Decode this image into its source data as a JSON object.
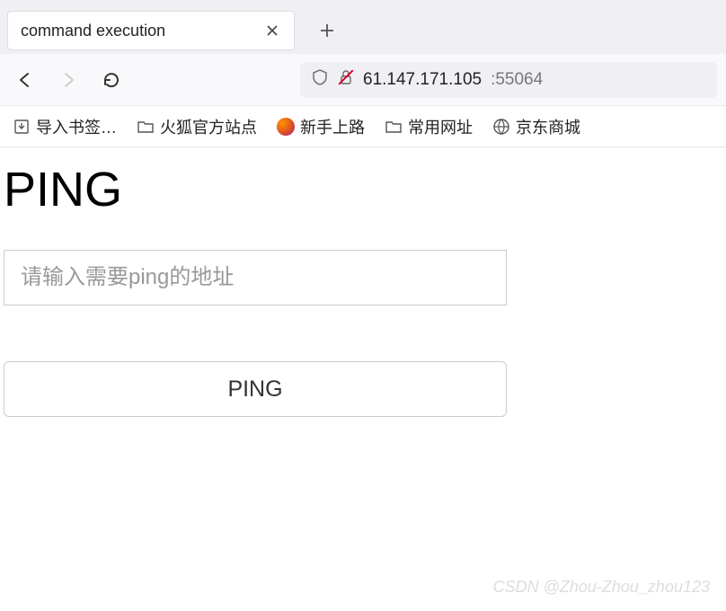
{
  "tab": {
    "title": "command execution"
  },
  "url": {
    "host": "61.147.171.105",
    "port": ":55064"
  },
  "bookmarks": {
    "import_label": "导入书签…",
    "firefox_official": "火狐官方站点",
    "getting_started": "新手上路",
    "common_sites": "常用网址",
    "jd_mall": "京东商城"
  },
  "page": {
    "heading": "PING",
    "input_placeholder": "请输入需要ping的地址",
    "button_label": "PING"
  },
  "watermark": "CSDN @Zhou-Zhou_zhou123"
}
